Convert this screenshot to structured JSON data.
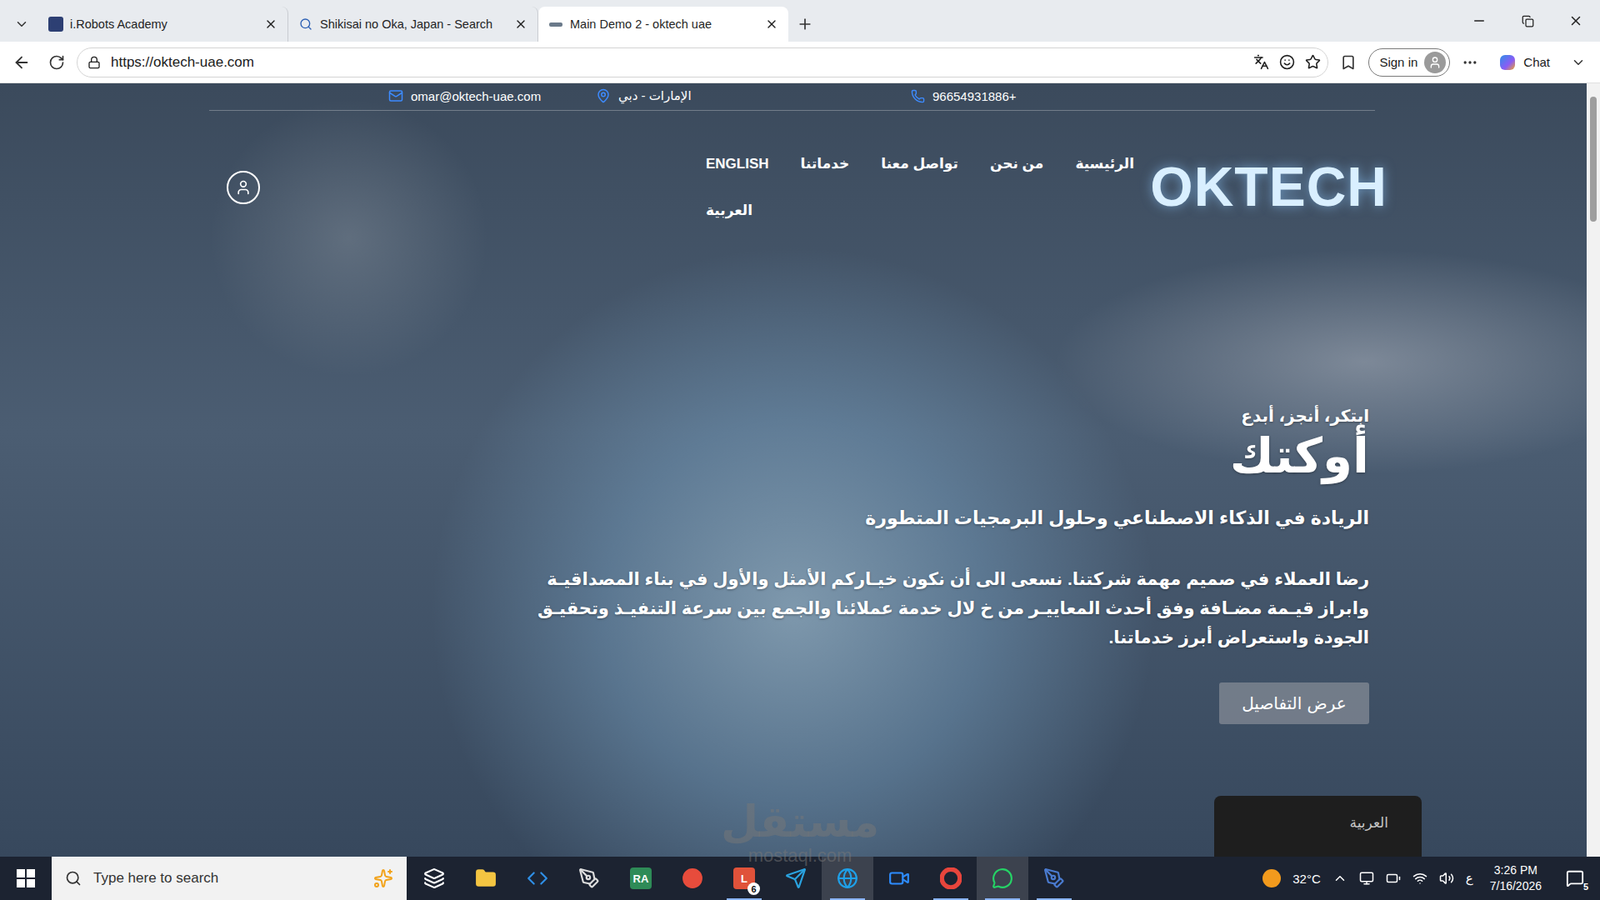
{
  "browser": {
    "tabs": [
      {
        "title": "i.Robots Academy",
        "selected": false,
        "kind": "site"
      },
      {
        "title": "Shikisai no Oka, Japan - Search",
        "selected": false,
        "kind": "search"
      },
      {
        "title": "Main Demo 2 - oktech uae",
        "selected": true,
        "kind": "logo"
      }
    ],
    "address": "https://oktech-uae.com",
    "sign_in": "Sign in",
    "chat": "Chat"
  },
  "site": {
    "contact": {
      "email": "omar@oktech-uae.com",
      "location": "الإمارات - دبي",
      "phone": "96654931886+"
    },
    "logo": "OKTECH",
    "nav": [
      {
        "label": "الرئيسية"
      },
      {
        "label": "من نحن"
      },
      {
        "label": "تواصل معنا"
      },
      {
        "label": "خدماتنا"
      },
      {
        "label": "ENGLISH"
      }
    ],
    "language_link": "العربية",
    "hero": {
      "tagline": "ابتكر، أنجز، أبدع",
      "title": "أوكتك",
      "subtitle": "الريادة في الذكاء الاصطناعي وحلول البرمجيات المتطورة",
      "body": "رضا العملاء في صميم مهمة شركتنا. نسعى الى أن نكون خيـاركم الأمثل والأول في بناء المصداقيـة وابراز قيـمة مضـافة وفق أحدث المعاييـر من خ لال خدمة عملائنا والجمع بين سرعة التنفيـذ وتحقيـق الجودة واستعراض أبرز خدماتنا.",
      "button": "عرض التفاصيل"
    },
    "language_popup": "العربية"
  },
  "watermark": {
    "brand": "مستقل",
    "domain": "mostaql.com"
  },
  "taskbar": {
    "search_placeholder": "Type here to search",
    "apps": [
      {
        "kind": "taskview",
        "color": "#ffffff",
        "running": false,
        "selected": false
      },
      {
        "kind": "folder",
        "color": "#f4c542",
        "running": false,
        "selected": false
      },
      {
        "kind": "code",
        "color": "#2f8fe6",
        "running": false,
        "selected": false
      },
      {
        "kind": "pen",
        "color": "#dddddd",
        "running": false,
        "selected": false
      },
      {
        "kind": "text",
        "glyph": "RA",
        "color": "#2e8b57",
        "running": false,
        "selected": false
      },
      {
        "kind": "app",
        "color": "#e74c3c",
        "running": false,
        "selected": false
      },
      {
        "kind": "text",
        "glyph": "L",
        "badge": "6",
        "color": "#e0523a",
        "running": true,
        "selected": false
      },
      {
        "kind": "send",
        "color": "#2aa3e0",
        "running": false,
        "selected": false
      },
      {
        "kind": "browser",
        "color": "#1fa0e8",
        "running": true,
        "selected": true
      },
      {
        "kind": "video",
        "color": "#2d8cff",
        "running": false,
        "selected": false
      },
      {
        "kind": "chrome",
        "color": "#e8453c",
        "running": true,
        "selected": false
      },
      {
        "kind": "chat",
        "color": "#25d366",
        "running": true,
        "selected": true
      },
      {
        "kind": "tool",
        "color": "#4a7bd0",
        "running": true,
        "selected": false
      }
    ],
    "temperature": "32°C",
    "input_language": "ع",
    "time": "3:26 PM",
    "date": "7/16/2026",
    "notifications": "5"
  }
}
